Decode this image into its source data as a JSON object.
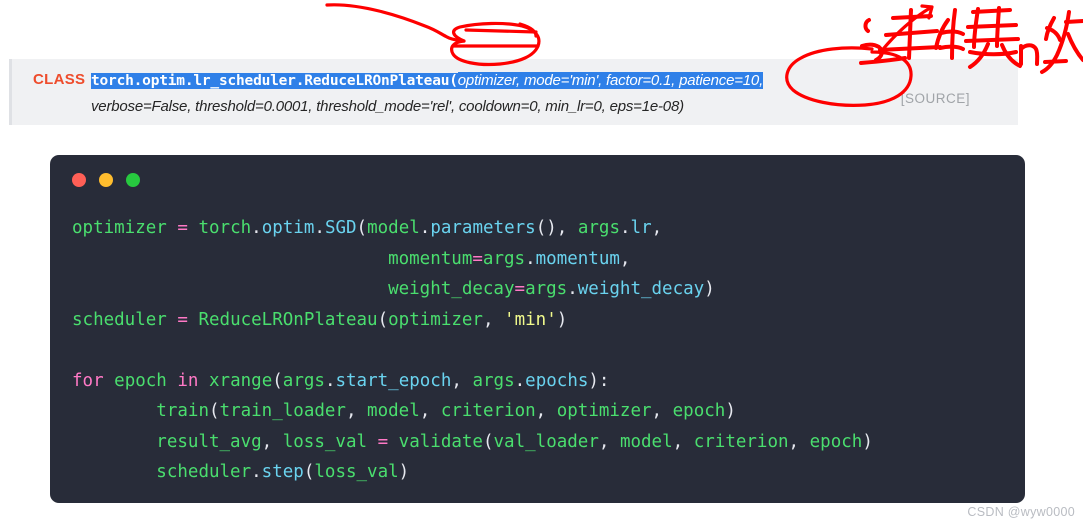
{
  "signature": {
    "class_label": "CLASS",
    "highlighted_name": "torch.optim.lr_scheduler.ReduceLROnPlateau(",
    "highlighted_params": "optimizer, mode='min', factor=0.1, patience=10,",
    "second_line": "verbose=False, threshold=0.0001, threshold_mode='rel', cooldown=0, min_lr=0, eps=1e-08)",
    "source_link": "[SOURCE]",
    "highlight_color": "#2f80e8",
    "class_label_color": "#ee4c2c",
    "background_color": "#f0f1f3"
  },
  "code_card": {
    "background_color": "#282c39",
    "dots": [
      {
        "name": "close-dot",
        "color": "#ff5f56"
      },
      {
        "name": "minimize-dot",
        "color": "#ffbd2e"
      },
      {
        "name": "maximize-dot",
        "color": "#27c93f"
      }
    ],
    "lines": [
      [
        {
          "t": "optimizer",
          "c": "tok-var"
        },
        {
          "t": " ",
          "c": "tok-plain"
        },
        {
          "t": "=",
          "c": "tok-op"
        },
        {
          "t": " ",
          "c": "tok-plain"
        },
        {
          "t": "torch",
          "c": "tok-var"
        },
        {
          "t": ".",
          "c": "tok-punc"
        },
        {
          "t": "optim",
          "c": "tok-fn"
        },
        {
          "t": ".",
          "c": "tok-punc"
        },
        {
          "t": "SGD",
          "c": "tok-fn"
        },
        {
          "t": "(",
          "c": "tok-punc"
        },
        {
          "t": "model",
          "c": "tok-var"
        },
        {
          "t": ".",
          "c": "tok-punc"
        },
        {
          "t": "parameters",
          "c": "tok-fn"
        },
        {
          "t": "(), ",
          "c": "tok-punc"
        },
        {
          "t": "args",
          "c": "tok-var"
        },
        {
          "t": ".",
          "c": "tok-punc"
        },
        {
          "t": "lr",
          "c": "tok-fn"
        },
        {
          "t": ",",
          "c": "tok-punc"
        }
      ],
      [
        {
          "t": "                              ",
          "c": "tok-plain"
        },
        {
          "t": "momentum",
          "c": "tok-var"
        },
        {
          "t": "=",
          "c": "tok-op"
        },
        {
          "t": "args",
          "c": "tok-var"
        },
        {
          "t": ".",
          "c": "tok-punc"
        },
        {
          "t": "momentum",
          "c": "tok-fn"
        },
        {
          "t": ",",
          "c": "tok-punc"
        }
      ],
      [
        {
          "t": "                              ",
          "c": "tok-plain"
        },
        {
          "t": "weight_decay",
          "c": "tok-var"
        },
        {
          "t": "=",
          "c": "tok-op"
        },
        {
          "t": "args",
          "c": "tok-var"
        },
        {
          "t": ".",
          "c": "tok-punc"
        },
        {
          "t": "weight_decay",
          "c": "tok-fn"
        },
        {
          "t": ")",
          "c": "tok-punc"
        }
      ],
      [
        {
          "t": "scheduler",
          "c": "tok-var"
        },
        {
          "t": " ",
          "c": "tok-plain"
        },
        {
          "t": "=",
          "c": "tok-op"
        },
        {
          "t": " ",
          "c": "tok-plain"
        },
        {
          "t": "ReduceLROnPlateau",
          "c": "tok-var"
        },
        {
          "t": "(",
          "c": "tok-punc"
        },
        {
          "t": "optimizer",
          "c": "tok-var"
        },
        {
          "t": ", ",
          "c": "tok-punc"
        },
        {
          "t": "'min'",
          "c": "tok-str"
        },
        {
          "t": ")",
          "c": "tok-punc"
        }
      ],
      [
        {
          "t": " ",
          "c": "tok-plain"
        }
      ],
      [
        {
          "t": "for",
          "c": "tok-kw"
        },
        {
          "t": " ",
          "c": "tok-plain"
        },
        {
          "t": "epoch",
          "c": "tok-var"
        },
        {
          "t": " ",
          "c": "tok-plain"
        },
        {
          "t": "in",
          "c": "tok-kw"
        },
        {
          "t": " ",
          "c": "tok-plain"
        },
        {
          "t": "xrange",
          "c": "tok-var"
        },
        {
          "t": "(",
          "c": "tok-punc"
        },
        {
          "t": "args",
          "c": "tok-var"
        },
        {
          "t": ".",
          "c": "tok-punc"
        },
        {
          "t": "start_epoch",
          "c": "tok-fn"
        },
        {
          "t": ", ",
          "c": "tok-punc"
        },
        {
          "t": "args",
          "c": "tok-var"
        },
        {
          "t": ".",
          "c": "tok-punc"
        },
        {
          "t": "epochs",
          "c": "tok-fn"
        },
        {
          "t": "):",
          "c": "tok-punc"
        }
      ],
      [
        {
          "t": "        ",
          "c": "tok-plain"
        },
        {
          "t": "train",
          "c": "tok-var"
        },
        {
          "t": "(",
          "c": "tok-punc"
        },
        {
          "t": "train_loader",
          "c": "tok-var"
        },
        {
          "t": ", ",
          "c": "tok-punc"
        },
        {
          "t": "model",
          "c": "tok-var"
        },
        {
          "t": ", ",
          "c": "tok-punc"
        },
        {
          "t": "criterion",
          "c": "tok-var"
        },
        {
          "t": ", ",
          "c": "tok-punc"
        },
        {
          "t": "optimizer",
          "c": "tok-var"
        },
        {
          "t": ", ",
          "c": "tok-punc"
        },
        {
          "t": "epoch",
          "c": "tok-var"
        },
        {
          "t": ")",
          "c": "tok-punc"
        }
      ],
      [
        {
          "t": "        ",
          "c": "tok-plain"
        },
        {
          "t": "result_avg",
          "c": "tok-var"
        },
        {
          "t": ", ",
          "c": "tok-punc"
        },
        {
          "t": "loss_val",
          "c": "tok-var"
        },
        {
          "t": " ",
          "c": "tok-plain"
        },
        {
          "t": "=",
          "c": "tok-op"
        },
        {
          "t": " ",
          "c": "tok-plain"
        },
        {
          "t": "validate",
          "c": "tok-var"
        },
        {
          "t": "(",
          "c": "tok-punc"
        },
        {
          "t": "val_loader",
          "c": "tok-var"
        },
        {
          "t": ", ",
          "c": "tok-punc"
        },
        {
          "t": "model",
          "c": "tok-var"
        },
        {
          "t": ", ",
          "c": "tok-punc"
        },
        {
          "t": "criterion",
          "c": "tok-var"
        },
        {
          "t": ", ",
          "c": "tok-punc"
        },
        {
          "t": "epoch",
          "c": "tok-var"
        },
        {
          "t": ")",
          "c": "tok-punc"
        }
      ],
      [
        {
          "t": "        ",
          "c": "tok-plain"
        },
        {
          "t": "scheduler",
          "c": "tok-var"
        },
        {
          "t": ".",
          "c": "tok-punc"
        },
        {
          "t": "step",
          "c": "tok-fn"
        },
        {
          "t": "(",
          "c": "tok-punc"
        },
        {
          "t": "loss_val",
          "c": "tok-var"
        },
        {
          "t": ")",
          "c": "tok-punc"
        }
      ]
    ]
  },
  "annotations": {
    "color": "#fe0000",
    "handwritten_text": "连续n次"
  },
  "watermark": {
    "text": "CSDN @wyw0000"
  }
}
